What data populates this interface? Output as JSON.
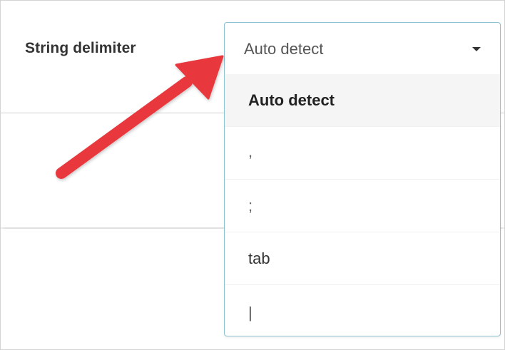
{
  "delimiter": {
    "label": "String delimiter",
    "current_value": "Auto detect",
    "options": [
      "Auto detect",
      ",",
      ";",
      "tab",
      "|"
    ],
    "selected_option": "Auto detect"
  },
  "annotation": {
    "arrow_color": "#e8383d"
  },
  "colors": {
    "dropdown_border": "#8cc1cf",
    "selected_option_bg": "#f5f5f5"
  }
}
